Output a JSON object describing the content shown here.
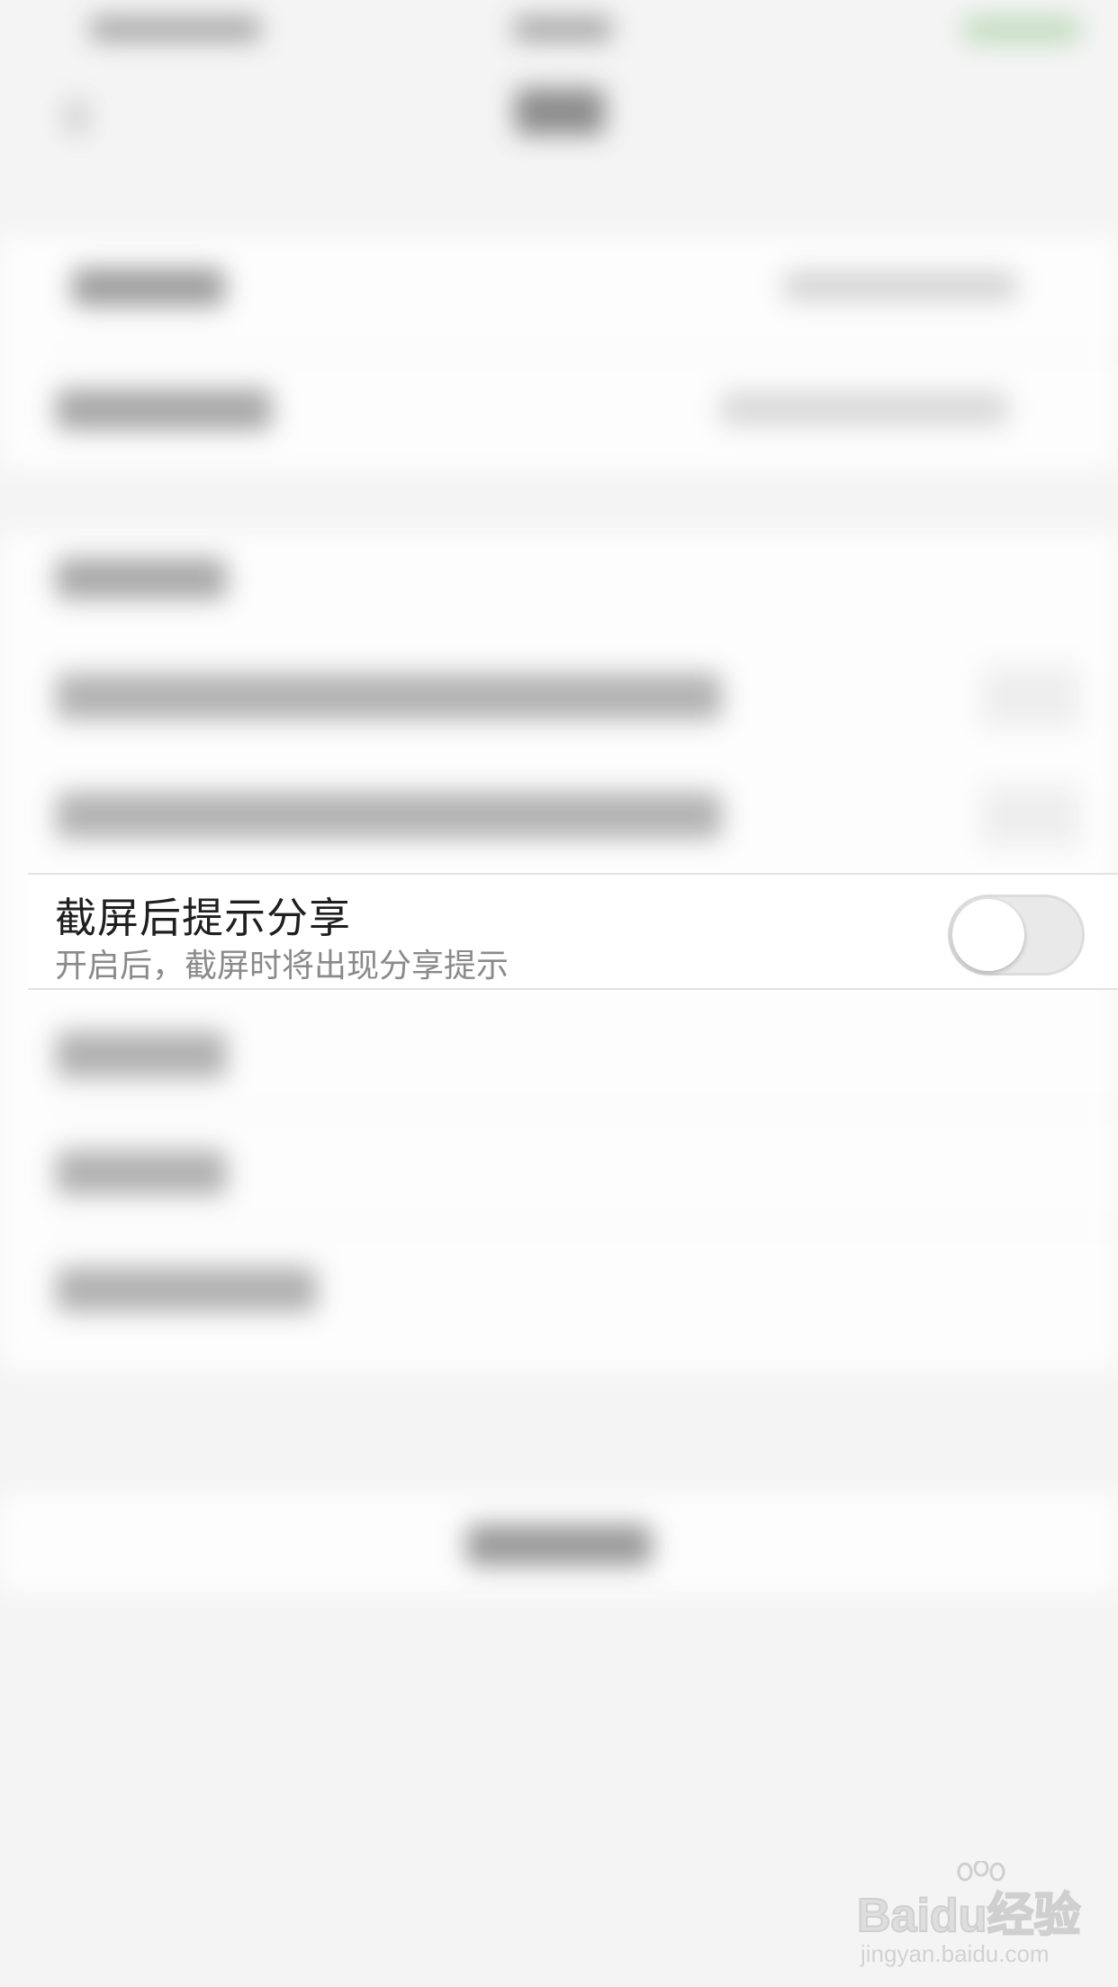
{
  "setting_row": {
    "title": "截屏后提示分享",
    "subtitle": "开启后，截屏时将出现分享提示",
    "toggle_on": false
  },
  "watermark": {
    "brand": "Baidu经验",
    "site": "jingyan.baidu.com"
  },
  "colors": {
    "background": "#f4f4f4",
    "row_background": "#ffffff",
    "title_text": "#1f1f1f",
    "subtitle_text": "#8a8a8a",
    "toggle_off_track": "#e9e9ea",
    "status_green": "#6cc36a"
  }
}
